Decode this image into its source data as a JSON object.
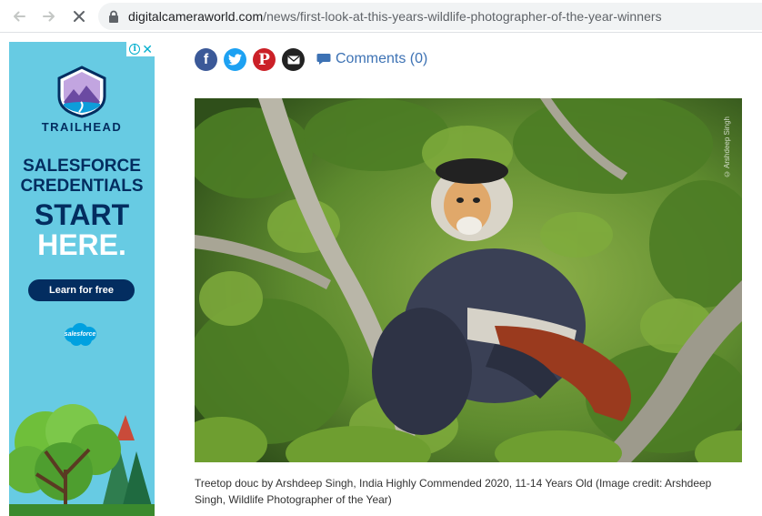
{
  "browser": {
    "url_host": "digitalcameraworld.com",
    "url_path": "/news/first-look-at-this-years-wildlife-photographer-of-the-year-winners",
    "icons": [
      "back-arrow-icon",
      "forward-arrow-icon",
      "stop-loading-icon",
      "lock-icon"
    ]
  },
  "ad": {
    "brand": "TRAILHEAD",
    "line1": "SALESFORCE",
    "line2": "CREDENTIALS",
    "line3": "START",
    "line4": "HERE.",
    "cta": "Learn for free",
    "sponsor": "salesforce",
    "colors": {
      "background": "#67cbe3",
      "navy": "#032d60"
    }
  },
  "share": {
    "facebook_glyph": "f",
    "pinterest_glyph": "P",
    "comments_label": "Comments (0)",
    "colors": {
      "facebook": "#3b5998",
      "twitter": "#1da1f2",
      "pinterest": "#cb2027",
      "email": "#222222",
      "link": "#3d72b4"
    }
  },
  "article": {
    "photo_credit_overlay": "© Arshdeep Singh",
    "caption": "Treetop douc by Arshdeep Singh, India Highly Commended 2020, 11-14 Years Old (Image credit: Arshdeep Singh, Wildlife Photographer of the Year)"
  }
}
